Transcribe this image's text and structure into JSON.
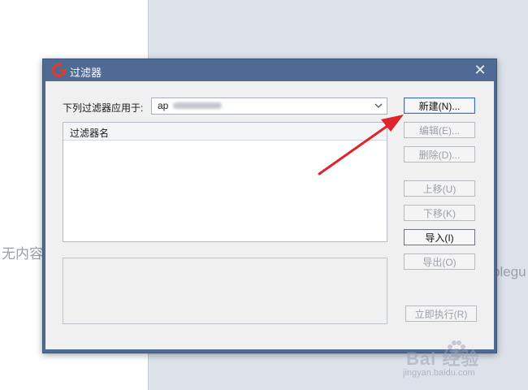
{
  "background": {
    "empty_text": "无内容",
    "side_text": "blegu"
  },
  "dialog": {
    "title": "过滤器",
    "apply_label": "下列过滤器应用于:",
    "apply_value": "ap",
    "list_header": "过滤器名"
  },
  "buttons": {
    "new": "新建(N)...",
    "edit": "编辑(E)...",
    "delete": "删除(D)...",
    "move_up": "上移(U)",
    "move_down": "下移(K)",
    "import": "导入(I)",
    "export": "导出(O)",
    "run_now": "立即执行(R)"
  },
  "watermark": {
    "brand": "Bai  经验",
    "url": "jingyan.baidu.com"
  },
  "colors": {
    "titlebar": "#4f6b93",
    "annotation_arrow": "#e0242b"
  }
}
